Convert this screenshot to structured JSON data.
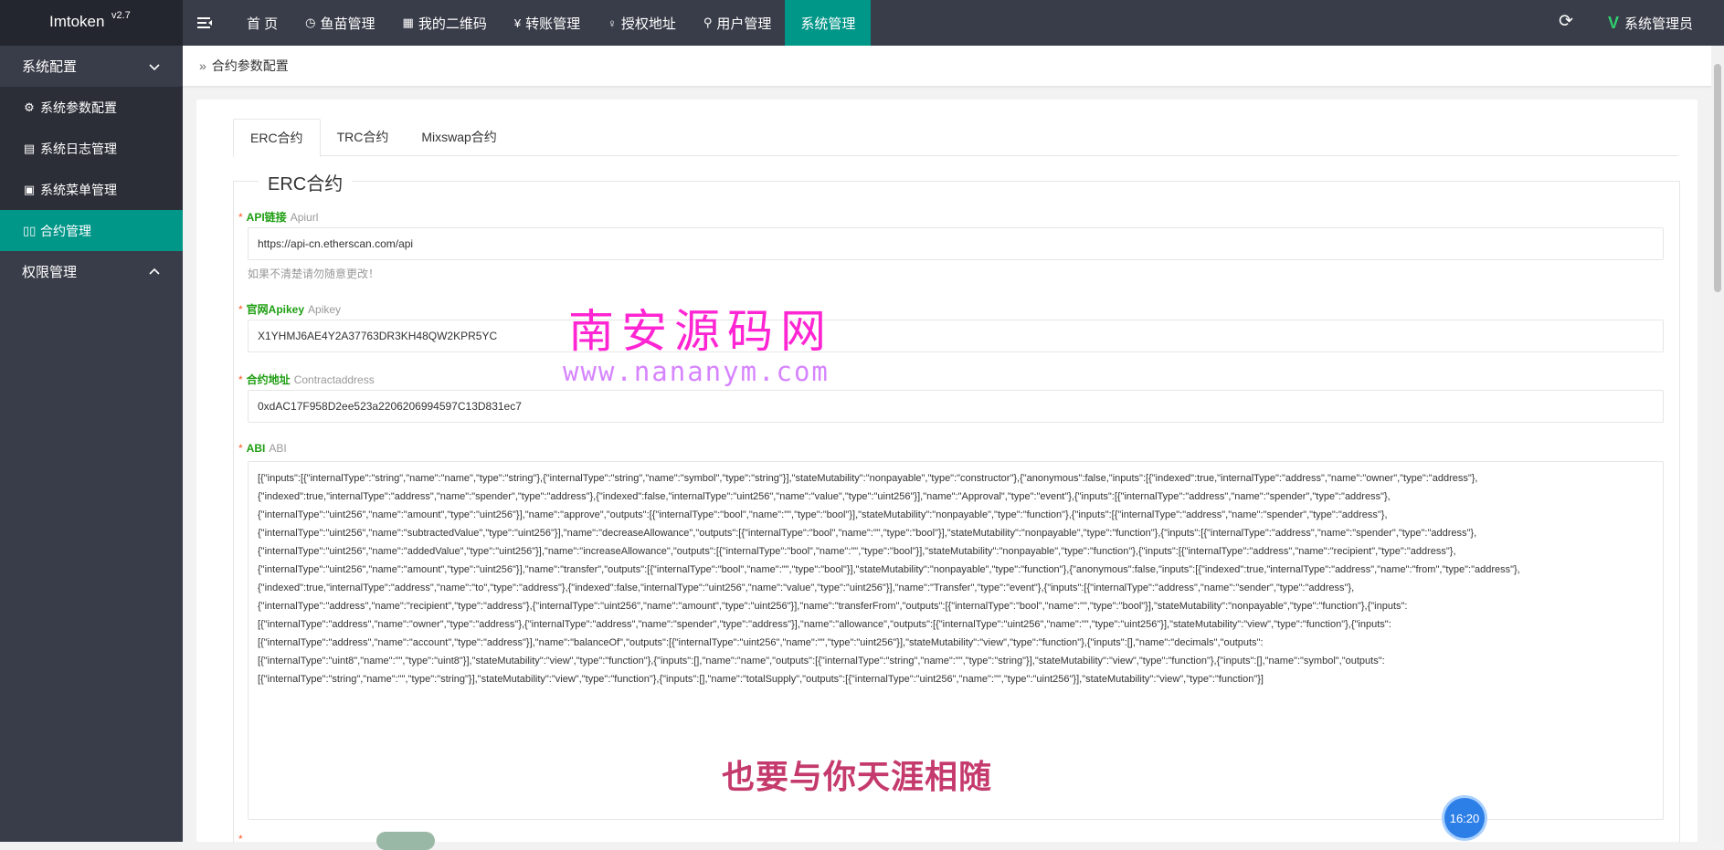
{
  "app": {
    "name": "Imtoken",
    "version": "v2.7"
  },
  "nav": [
    {
      "label": "首 页",
      "icon": ""
    },
    {
      "label": "鱼苗管理",
      "icon": "clock-icon"
    },
    {
      "label": "我的二维码",
      "icon": "qrcode-icon"
    },
    {
      "label": "转账管理",
      "icon": "yen-icon"
    },
    {
      "label": "授权地址",
      "icon": "bulb-icon"
    },
    {
      "label": "用户管理",
      "icon": "user-icon"
    },
    {
      "label": "系统管理",
      "icon": "",
      "active": true
    }
  ],
  "user": {
    "label": "系统管理员"
  },
  "sidebar": {
    "group1": "系统配置",
    "items": [
      {
        "label": "系统参数配置",
        "icon": "gear-icon"
      },
      {
        "label": "系统日志管理",
        "icon": "log-icon"
      },
      {
        "label": "系统菜单管理",
        "icon": "menu-table-icon"
      },
      {
        "label": "合约管理",
        "icon": "contract-icon",
        "active": true
      }
    ],
    "group2": "权限管理"
  },
  "breadcrumb": "合约参数配置",
  "tabs": [
    "ERC合约",
    "TRC合约",
    "Mixswap合约"
  ],
  "section_title": "ERC合约",
  "fields": {
    "api": {
      "key": "API链接",
      "sub": "Apiurl",
      "value": "https://api-cn.etherscan.com/api",
      "help": "如果不清楚请勿随意更改！"
    },
    "apikey": {
      "key": "官网Apikey",
      "sub": "Apikey",
      "value": "X1YHMJ6AE4Y2A37763DR3KH48QW2KPR5YC"
    },
    "contract": {
      "key": "合约地址",
      "sub": "Contractaddress",
      "value": "0xdAC17F958D2ee523a2206206994597C13D831ec7"
    },
    "abi": {
      "key": "ABI",
      "sub": "ABI"
    }
  },
  "abi_lines": [
    "[{\"inputs\":[{\"internalType\":\"string\",\"name\":\"name\",\"type\":\"string\"},{\"internalType\":\"string\",\"name\":\"symbol\",\"type\":\"string\"}],\"stateMutability\":\"nonpayable\",\"type\":\"constructor\"},{\"anonymous\":false,\"inputs\":[{\"indexed\":true,\"internalType\":\"address\",\"name\":\"owner\",\"type\":\"address\"},",
    "{\"indexed\":true,\"internalType\":\"address\",\"name\":\"spender\",\"type\":\"address\"},{\"indexed\":false,\"internalType\":\"uint256\",\"name\":\"value\",\"type\":\"uint256\"}],\"name\":\"Approval\",\"type\":\"event\"},{\"inputs\":[{\"internalType\":\"address\",\"name\":\"spender\",\"type\":\"address\"},",
    "{\"internalType\":\"uint256\",\"name\":\"amount\",\"type\":\"uint256\"}],\"name\":\"approve\",\"outputs\":[{\"internalType\":\"bool\",\"name\":\"\",\"type\":\"bool\"}],\"stateMutability\":\"nonpayable\",\"type\":\"function\"},{\"inputs\":[{\"internalType\":\"address\",\"name\":\"spender\",\"type\":\"address\"},",
    "{\"internalType\":\"uint256\",\"name\":\"subtractedValue\",\"type\":\"uint256\"}],\"name\":\"decreaseAllowance\",\"outputs\":[{\"internalType\":\"bool\",\"name\":\"\",\"type\":\"bool\"}],\"stateMutability\":\"nonpayable\",\"type\":\"function\"},{\"inputs\":[{\"internalType\":\"address\",\"name\":\"spender\",\"type\":\"address\"},",
    "{\"internalType\":\"uint256\",\"name\":\"addedValue\",\"type\":\"uint256\"}],\"name\":\"increaseAllowance\",\"outputs\":[{\"internalType\":\"bool\",\"name\":\"\",\"type\":\"bool\"}],\"stateMutability\":\"nonpayable\",\"type\":\"function\"},{\"inputs\":[{\"internalType\":\"address\",\"name\":\"recipient\",\"type\":\"address\"},",
    "{\"internalType\":\"uint256\",\"name\":\"amount\",\"type\":\"uint256\"}],\"name\":\"transfer\",\"outputs\":[{\"internalType\":\"bool\",\"name\":\"\",\"type\":\"bool\"}],\"stateMutability\":\"nonpayable\",\"type\":\"function\"},{\"anonymous\":false,\"inputs\":[{\"indexed\":true,\"internalType\":\"address\",\"name\":\"from\",\"type\":\"address\"},",
    "{\"indexed\":true,\"internalType\":\"address\",\"name\":\"to\",\"type\":\"address\"},{\"indexed\":false,\"internalType\":\"uint256\",\"name\":\"value\",\"type\":\"uint256\"}],\"name\":\"Transfer\",\"type\":\"event\"},{\"inputs\":[{\"internalType\":\"address\",\"name\":\"sender\",\"type\":\"address\"},",
    "{\"internalType\":\"address\",\"name\":\"recipient\",\"type\":\"address\"},{\"internalType\":\"uint256\",\"name\":\"amount\",\"type\":\"uint256\"}],\"name\":\"transferFrom\",\"outputs\":[{\"internalType\":\"bool\",\"name\":\"\",\"type\":\"bool\"}],\"stateMutability\":\"nonpayable\",\"type\":\"function\"},{\"inputs\":",
    "[{\"internalType\":\"address\",\"name\":\"owner\",\"type\":\"address\"},{\"internalType\":\"address\",\"name\":\"spender\",\"type\":\"address\"}],\"name\":\"allowance\",\"outputs\":[{\"internalType\":\"uint256\",\"name\":\"\",\"type\":\"uint256\"}],\"stateMutability\":\"view\",\"type\":\"function\"},{\"inputs\":",
    "[{\"internalType\":\"address\",\"name\":\"account\",\"type\":\"address\"}],\"name\":\"balanceOf\",\"outputs\":[{\"internalType\":\"uint256\",\"name\":\"\",\"type\":\"uint256\"}],\"stateMutability\":\"view\",\"type\":\"function\"},{\"inputs\":[],\"name\":\"decimals\",\"outputs\":",
    "[{\"internalType\":\"uint8\",\"name\":\"\",\"type\":\"uint8\"}],\"stateMutability\":\"view\",\"type\":\"function\"},{\"inputs\":[],\"name\":\"name\",\"outputs\":[{\"internalType\":\"string\",\"name\":\"\",\"type\":\"string\"}],\"stateMutability\":\"view\",\"type\":\"function\"},{\"inputs\":[],\"name\":\"symbol\",\"outputs\":",
    "[{\"internalType\":\"string\",\"name\":\"\",\"type\":\"string\"}],\"stateMutability\":\"view\",\"type\":\"function\"},{\"inputs\":[],\"name\":\"totalSupply\",\"outputs\":[{\"internalType\":\"uint256\",\"name\":\"\",\"type\":\"uint256\"}],\"stateMutability\":\"view\",\"type\":\"function\"}]"
  ],
  "watermark": {
    "title": "南安源码网",
    "url": "www.nananym.com"
  },
  "caption": "也要与你天涯相随",
  "clock": "16:20",
  "colors": {
    "topbar": "#393d49",
    "accent": "#009688",
    "label_green": "#1e9e12",
    "required": "#ff5722"
  }
}
